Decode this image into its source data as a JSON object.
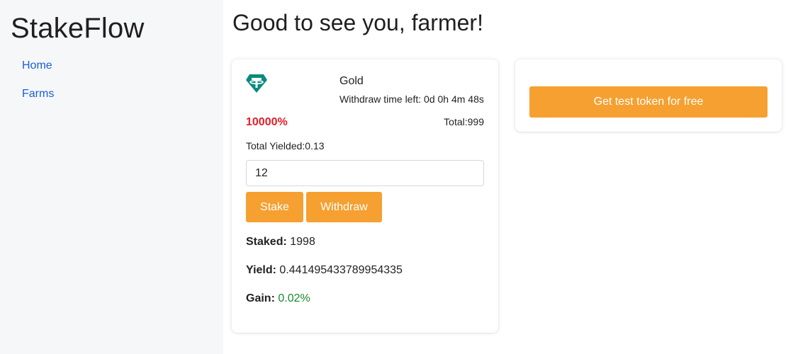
{
  "app": {
    "brand": "StakeFlow"
  },
  "nav": {
    "items": [
      {
        "label": "Home"
      },
      {
        "label": "Farms"
      }
    ]
  },
  "header": {
    "greeting": "Good to see you, farmer!"
  },
  "farm": {
    "icon": "tether-token-icon",
    "name": "Gold",
    "withdraw_label": "Withdraw time left:",
    "withdraw_value": "0d 0h 4m 48s",
    "apy": "10000%",
    "total_label": "Total:",
    "total_value": "999",
    "yielded_label": "Total Yielded:",
    "yielded_value": "0.13",
    "amount_value": "12",
    "stake_label": "Stake",
    "withdraw_button_label": "Withdraw",
    "staked_label": "Staked:",
    "staked_value": "1998",
    "yield_label": "Yield:",
    "yield_value": "0.441495433789954335",
    "gain_label": "Gain:",
    "gain_value": "0.02%"
  },
  "faucet": {
    "button_label": "Get test token for free"
  },
  "colors": {
    "accent": "#f5a030",
    "link": "#1a5fd6",
    "apy": "#e0202b",
    "gain": "#188a2a",
    "token": "#0b8a7d",
    "sidebar_bg": "#f6f7f9"
  }
}
